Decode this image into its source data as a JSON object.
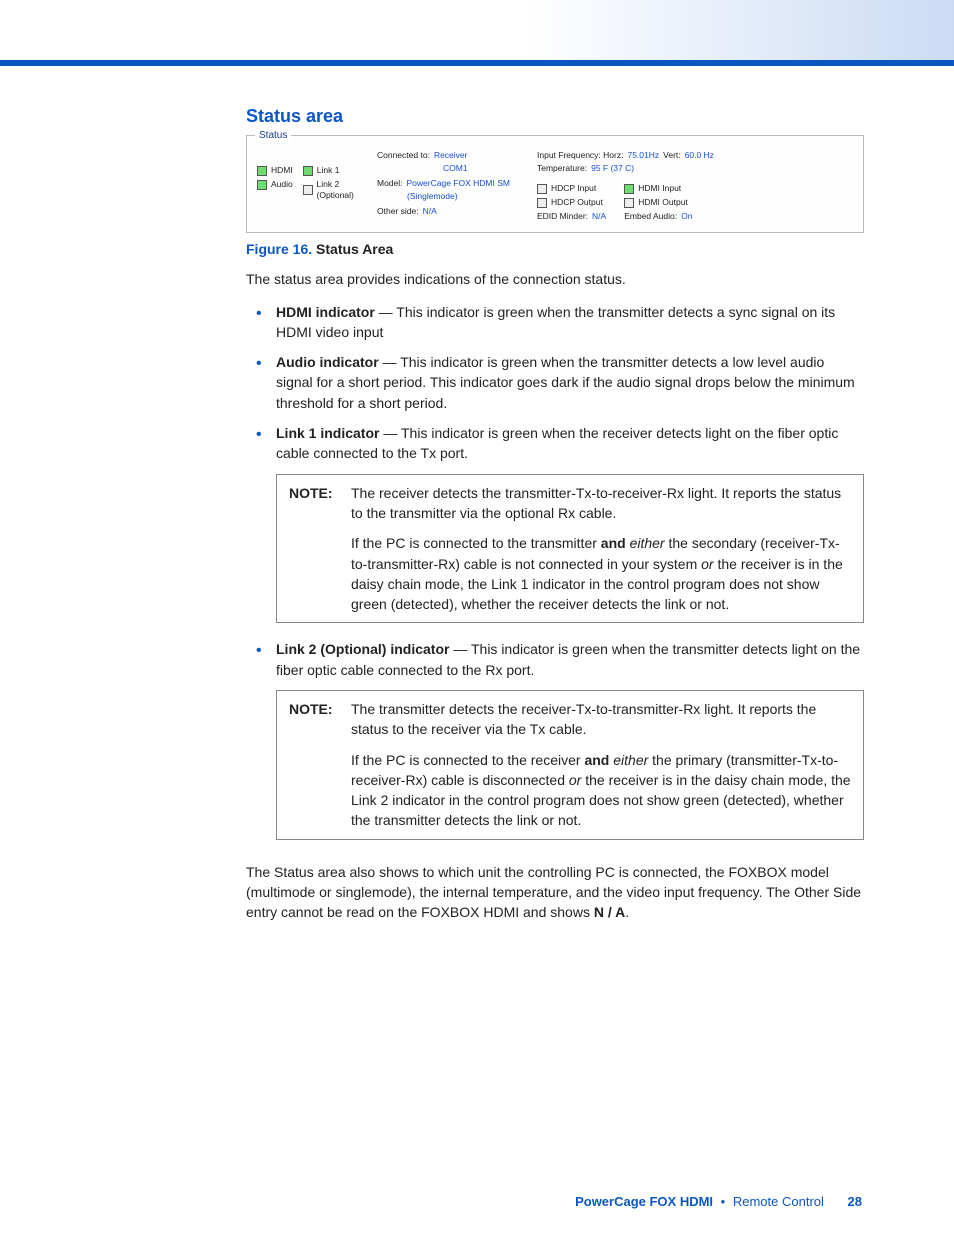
{
  "heading": "Status area",
  "statusPanel": {
    "legend": "Status",
    "indicators": {
      "hdmi": "HDMI",
      "audio": "Audio",
      "link1": "Link 1",
      "link2": "Link 2  (Optional)"
    },
    "connectedToLabel": "Connected to:",
    "connectedTo1": "Receiver",
    "connectedTo2": "COM1",
    "modelLabel": "Model:",
    "model1": "PowerCage FOX HDMI SM",
    "model2": "(Singlemode)",
    "otherSideLabel": "Other side:",
    "otherSide": "N/A",
    "inputFreqLabel": "Input Frequency:  Horz:",
    "inputFreqH": "75.01Hz",
    "inputFreqVLabel": "Vert:",
    "inputFreqV": "60.0 Hz",
    "tempLabel": "Temperature:",
    "temp": "95 F (37 C)",
    "hdcpInput": "HDCP Input",
    "hdcpOutput": "HDCP Output",
    "hdmiInput": "HDMI Input",
    "hdmiOutput": "HDMI Output",
    "edidLabel": "EDID Minder:",
    "edid": "N/A",
    "embedLabel": "Embed Audio:",
    "embed": "On"
  },
  "figure": {
    "num": "Figure 16.",
    "title": "Status Area"
  },
  "intro": "The status area provides indications of the connection status.",
  "bullets": {
    "b1": {
      "term": "HDMI indicator",
      "text": " — This indicator is green when the transmitter detects a sync signal on its HDMI video input"
    },
    "b2": {
      "term": "Audio indicator",
      "text": " — This indicator is green when the transmitter detects a low level audio signal for a short period. This indicator goes dark if the audio signal drops below the minimum threshold for a short period."
    },
    "b3": {
      "term": "Link 1 indicator",
      "text": " — This indicator is green when the receiver detects light on the fiber optic cable connected to the Tx port."
    },
    "b4": {
      "term": "Link 2 (Optional) indicator",
      "text": " — This indicator is green when the transmitter detects light on the fiber optic cable connected to the Rx port."
    }
  },
  "note1": {
    "label": "NOTE:",
    "p1": "The receiver detects the transmitter-Tx-to-receiver-Rx light. It reports the status to the transmitter via the optional Rx cable.",
    "p2a": "If the PC is connected to the transmitter ",
    "p2and": "and",
    "p2b": " ",
    "p2either": "either",
    "p2c": " the secondary (receiver-Tx-to-transmitter-Rx) cable is not connected in your system ",
    "p2or": "or",
    "p2d": " the receiver is in the daisy chain mode, the Link 1 indicator in the control program does not show green (detected), whether the receiver detects the link or not."
  },
  "note2": {
    "label": "NOTE:",
    "p1": "The transmitter detects the receiver-Tx-to-transmitter-Rx light. It reports the status to the receiver via the Tx cable.",
    "p2a": "If the PC is connected to the receiver ",
    "p2and": "and",
    "p2b": " ",
    "p2either": "either",
    "p2c": " the primary (transmitter-Tx-to-receiver-Rx) cable is disconnected ",
    "p2or": "or",
    "p2d": " the receiver is in the daisy chain mode, the Link 2 indicator in the control program does not show green (detected), whether the transmitter detects the link or not."
  },
  "closing": {
    "a": "The Status area also shows to which unit the controlling PC is connected, the FOXBOX model (multimode or singlemode), the internal temperature, and the video input frequency. The Other Side entry cannot be read on the FOXBOX HDMI and shows ",
    "na": "N / A",
    "b": "."
  },
  "footer": {
    "title": "PowerCage FOX HDMI",
    "dot": "•",
    "section": "Remote Control",
    "page": "28"
  }
}
